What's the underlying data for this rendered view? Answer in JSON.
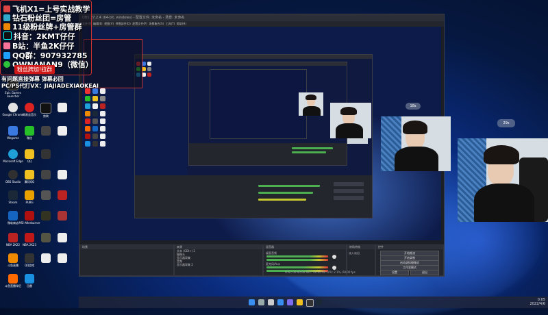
{
  "overlay": {
    "lines": [
      "飞机X1=上号实战教学",
      "钻石粉丝团=房管",
      "11级粉丝牌+房管群",
      "抖音：2KMT仔仔",
      "B站：半鱼2K仔仔",
      "QQ群：907932785",
      "OWNANAN9（微信）"
    ],
    "tag": "粉丝牌加!拉群",
    "contact1": "有问题直接弹幕 弹幕必回",
    "contact2": "PC/PS代打VX：JIAJIADEXIAOKEAI"
  },
  "desktop_icons": [
    "Epic Games Launcher",
    "Google Chrome",
    "Wegame",
    "Microsoft Edge",
    "OBS Studio",
    "Steam",
    "微软商店",
    "NBA 2K22",
    "斗鱼直播",
    "斗鱼直播伴侣",
    "网易云音乐",
    "剪映",
    "微信",
    "QQ",
    "腾讯QQ",
    "PUBG",
    "MSI Afterburner",
    "NBA 2K23",
    "QQ游戏",
    "迅雷"
  ],
  "obs": {
    "title": "OBS 27.2.4 (64-bit, windows) - 配置文件: 未命名 - 场景: 未命名",
    "menu": [
      "文件(F)",
      "编辑(E)",
      "视图(V)",
      "停靠部件(D)",
      "配置文件(P)",
      "场景集合(S)",
      "工具(T)",
      "帮助(H)"
    ],
    "docks": {
      "scenes": "场景",
      "sources": "来源",
      "mixer": "混音器",
      "transitions": "转场特效",
      "controls": "控件"
    },
    "sources_list": [
      "文本 (GDI+) 2",
      "摄像头",
      "显示器采集",
      "音频",
      "显示器采集 2"
    ],
    "control_buttons": [
      "开始推流",
      "开始录制",
      "启动虚拟摄像机",
      "工作室模式",
      "设置",
      "退出"
    ],
    "mixer_label_a": "桌面音频",
    "mixer_label_b": "麦克风/Aux",
    "transition_value": "淡入淡出",
    "status": "LIVE: 00:00:00  REC: 00:00:00  CPU: 2.1%, 60.00 fps"
  },
  "bubbles": [
    "29s",
    "18s"
  ],
  "taskbar": {
    "time": "0:05",
    "date": "2022/4/6"
  }
}
